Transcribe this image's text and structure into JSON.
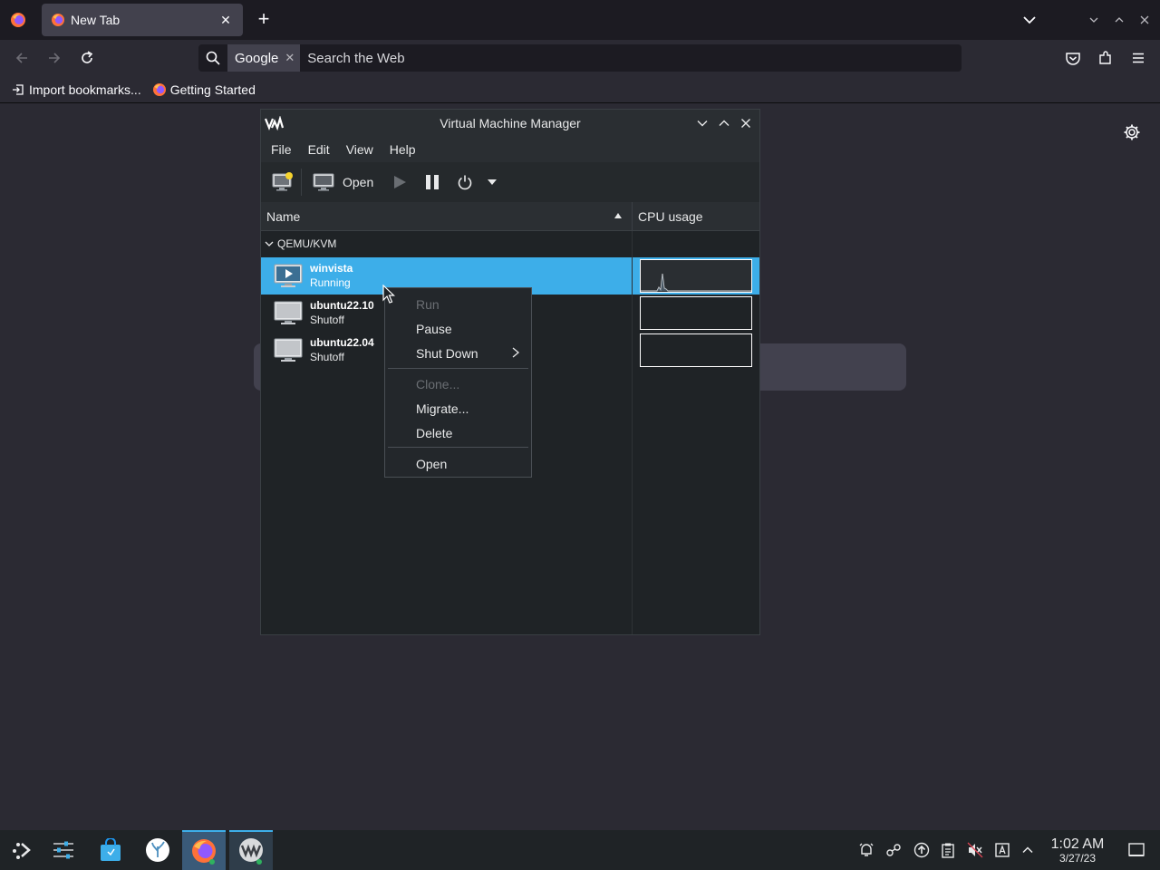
{
  "browser": {
    "tab": {
      "title": "New Tab"
    },
    "urlbar": {
      "engine": "Google",
      "placeholder": "Search the Web"
    },
    "bookmarks": [
      {
        "label": "Import bookmarks..."
      },
      {
        "label": "Getting Started"
      }
    ]
  },
  "vmm": {
    "title": "Virtual Machine Manager",
    "menus": [
      "File",
      "Edit",
      "View",
      "Help"
    ],
    "toolbar": {
      "open_label": "Open"
    },
    "columns": {
      "name": "Name",
      "cpu": "CPU usage"
    },
    "group": "QEMU/KVM",
    "vms": [
      {
        "name": "winvista",
        "state": "Running"
      },
      {
        "name": "ubuntu22.10",
        "state": "Shutoff"
      },
      {
        "name": "ubuntu22.04",
        "state": "Shutoff"
      }
    ]
  },
  "context_menu": {
    "items": [
      "Run",
      "Pause",
      "Shut Down",
      "Clone...",
      "Migrate...",
      "Delete",
      "Open"
    ]
  },
  "taskbar": {
    "time": "1:02 AM",
    "date": "3/27/23"
  },
  "colors": {
    "selection": "#3daee9",
    "firefox_bg": "#2b2a33",
    "toolbar_dark": "#1c1b22"
  }
}
